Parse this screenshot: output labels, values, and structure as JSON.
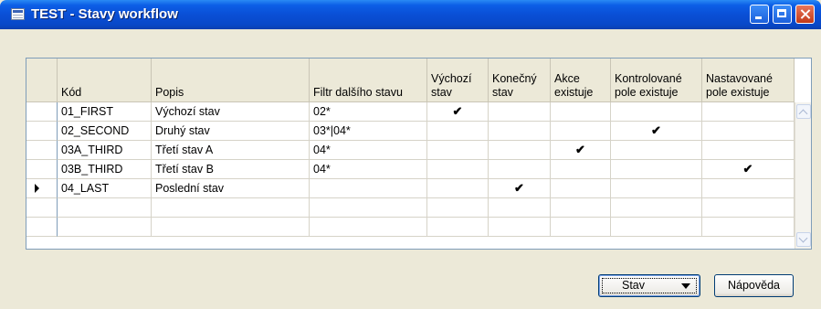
{
  "window": {
    "title": "TEST - Stavy workflow"
  },
  "columns": [
    {
      "label": "Kód"
    },
    {
      "label": "Popis"
    },
    {
      "label": "Filtr dalšího stavu"
    },
    {
      "label": "Výchozí\nstav"
    },
    {
      "label": "Konečný\nstav"
    },
    {
      "label": "Akce\nexistuje"
    },
    {
      "label": "Kontrolované\npole existuje"
    },
    {
      "label": "Nastavované\npole existuje"
    }
  ],
  "rows": [
    {
      "code": "01_FIRST",
      "description": "Výchozí stav",
      "filter": "02*",
      "initial": true,
      "final": false,
      "action": false,
      "checked": false,
      "set": false,
      "current": false
    },
    {
      "code": "02_SECOND",
      "description": "Druhý stav",
      "filter": "03*|04*",
      "initial": false,
      "final": false,
      "action": false,
      "checked": true,
      "set": false,
      "current": false
    },
    {
      "code": "03A_THIRD",
      "description": "Třetí stav A",
      "filter": "04*",
      "initial": false,
      "final": false,
      "action": true,
      "checked": false,
      "set": false,
      "current": false
    },
    {
      "code": "03B_THIRD",
      "description": "Třetí stav B",
      "filter": "04*",
      "initial": false,
      "final": false,
      "action": false,
      "checked": false,
      "set": true,
      "current": false
    },
    {
      "code": "04_LAST",
      "description": "Poslední stav",
      "filter": "",
      "initial": false,
      "final": true,
      "action": false,
      "checked": false,
      "set": false,
      "current": true
    },
    {
      "code": "",
      "description": "",
      "filter": "",
      "initial": false,
      "final": false,
      "action": false,
      "checked": false,
      "set": false,
      "current": false
    },
    {
      "code": "",
      "description": "",
      "filter": "",
      "initial": false,
      "final": false,
      "action": false,
      "checked": false,
      "set": false,
      "current": false
    }
  ],
  "check_glyph": "✔",
  "buttons": {
    "stav": "Stav",
    "help": "Nápověda"
  }
}
